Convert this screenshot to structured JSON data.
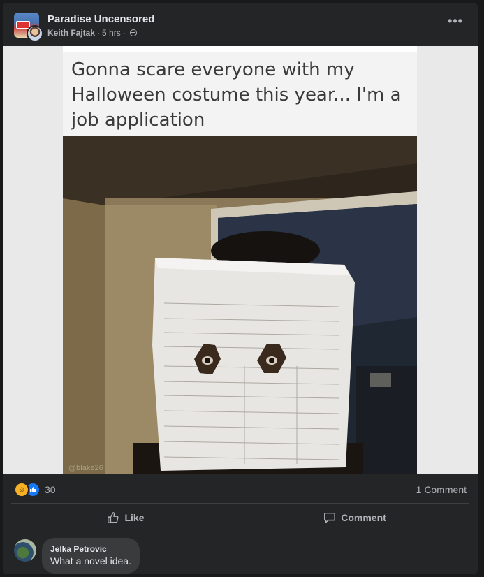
{
  "post": {
    "group_name": "Paradise Uncensored",
    "author": "Keith Fajtak",
    "time": "5 hrs",
    "separator": "·",
    "privacy_icon": "globe-icon",
    "more_icon": "more-horizontal-icon",
    "more_label": "•••"
  },
  "image": {
    "caption": "Gonna scare everyone with my Halloween costume this year... I'm a job application",
    "watermark": "@blake26"
  },
  "stats": {
    "reaction_icons": [
      "haha-icon",
      "like-icon"
    ],
    "reaction_count": "30",
    "comment_count": "1 Comment"
  },
  "actions": {
    "like_label": "Like",
    "comment_label": "Comment"
  },
  "comments": [
    {
      "author": "Jelka Petrovic",
      "text": "What a novel idea."
    }
  ],
  "colors": {
    "background": "#18191a",
    "card": "#242526",
    "text_primary": "#e4e6eb",
    "text_secondary": "#b0b3b8",
    "like_blue": "#1877f2",
    "haha_yellow": "#f7b125",
    "comment_bubble": "#3a3b3c"
  }
}
